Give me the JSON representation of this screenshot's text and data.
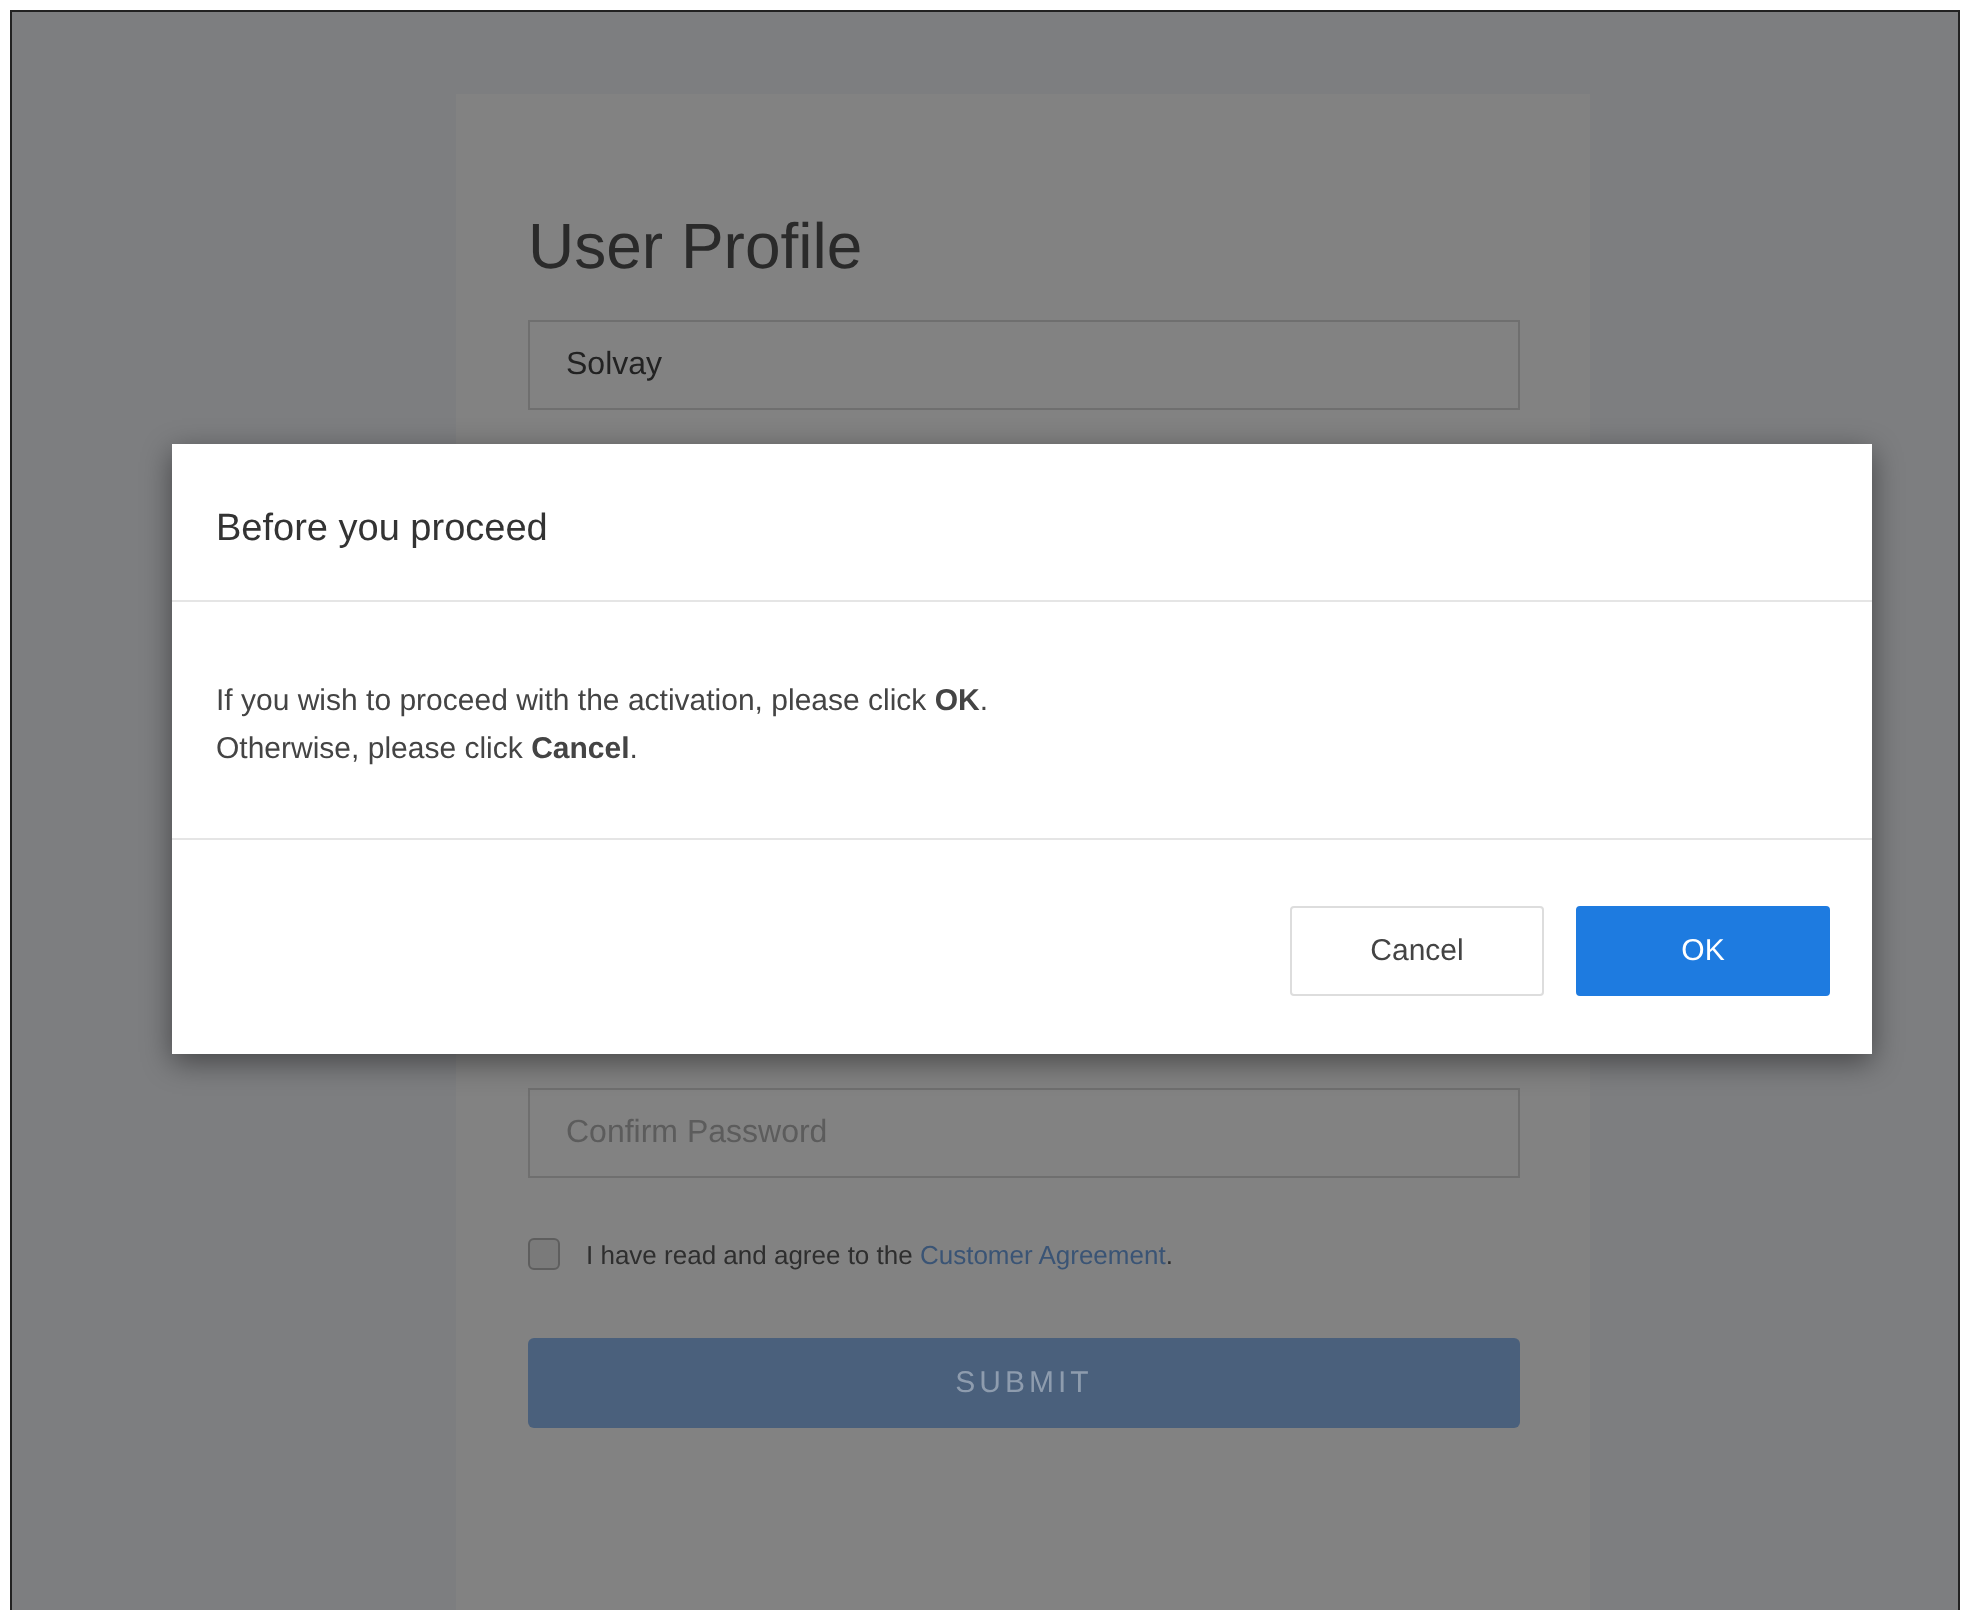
{
  "profile_form": {
    "title": "User Profile",
    "fields": [
      {
        "value": "Solvay"
      }
    ],
    "confirm_password": {
      "placeholder": "Confirm Password"
    },
    "agreement": {
      "checked": false,
      "text": "I have read and agree to the",
      "link": "Customer Agreement",
      "after": "."
    },
    "submit_button": "SUBMIT"
  },
  "dialog": {
    "title": "Before you proceed",
    "message_lines": [
      "If you wish to proceed with the activation, please click **OK**.",
      "Otherwise, please click **Cancel**."
    ],
    "buttons": [
      {
        "label": "Cancel",
        "kind": "secondary"
      },
      {
        "label": "OK",
        "kind": "primary"
      }
    ]
  }
}
